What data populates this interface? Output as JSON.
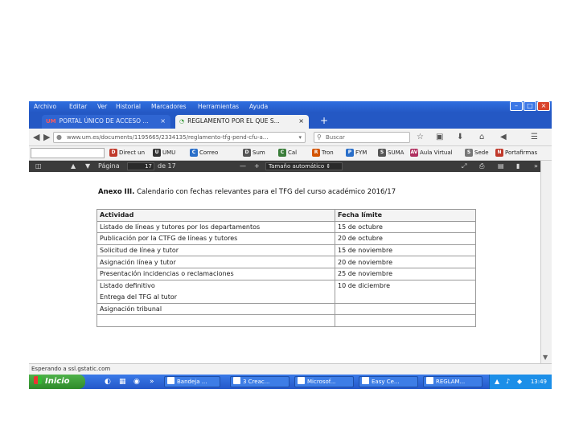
{
  "menu": [
    "Archivo",
    "Editar",
    "Ver",
    "Historial",
    "Marcadores",
    "Herramientas",
    "Ayuda"
  ],
  "tabs": [
    {
      "favicon": "UM",
      "label": "PORTAL ÚNICO DE ACCESO ...",
      "close": "×"
    },
    {
      "favicon": "◔",
      "label": "REGLAMENTO POR EL QUE S...",
      "close": "×"
    }
  ],
  "new_tab": "+",
  "nav": {
    "url": "www.um.es/documents/1195665/2334135/reglamento-tfg-pend-cfu-a...",
    "search_placeholder": "Buscar"
  },
  "bookmarks": [
    {
      "icon": "D",
      "label": "Direct un",
      "color": "#c0392b"
    },
    {
      "icon": "U",
      "label": "UMU",
      "color": "#333333"
    },
    {
      "icon": "C",
      "label": "Correo",
      "color": "#2a6fc9"
    },
    {
      "icon": "D",
      "label": "Sum",
      "color": "#555555"
    },
    {
      "icon": "C",
      "label": "Cal",
      "color": "#3a7d3a"
    },
    {
      "icon": "R",
      "label": "Tron",
      "color": "#d35400"
    },
    {
      "icon": "P",
      "label": "FYM",
      "color": "#2a6fc9"
    },
    {
      "icon": "S",
      "label": "SUMA",
      "color": "#555555"
    },
    {
      "icon": "AV",
      "label": "Aula Virtual",
      "color": "#b03060"
    },
    {
      "icon": "S",
      "label": "Sede",
      "color": "#777777"
    },
    {
      "icon": "N",
      "label": "Portafirmas",
      "color": "#c0392b"
    }
  ],
  "pdf": {
    "page_label": "Página",
    "page_current": "17",
    "page_total": "de 17",
    "zoom": "Tamaño automático"
  },
  "document": {
    "annex": "Anexo III.",
    "title_rest": " Calendario con fechas relevantes para el TFG del curso académico 2016/17",
    "headers": [
      "Actividad",
      "Fecha límite"
    ],
    "rows": [
      [
        "Listado de líneas y tutores por los departamentos",
        "15 de octubre"
      ],
      [
        "Publicación por la CTFG de líneas y tutores",
        "20 de octubre"
      ],
      [
        "Solicitud de línea y tutor",
        "15 de noviembre"
      ],
      [
        "Asignación línea y tutor",
        "20 de noviembre"
      ],
      [
        "Presentación incidencias o reclamaciones",
        "25 de noviembre"
      ],
      [
        "Listado definitivo",
        "10 de diciembre"
      ],
      [
        "Entrega del TFG al tutor",
        ""
      ],
      [
        "Asignación tribunal",
        ""
      ],
      [
        "",
        ""
      ]
    ]
  },
  "status": "Esperando a ssl.gstatic.com",
  "taskbar": {
    "start": "Inicio",
    "tasks": [
      "Bandeja ...",
      "3 Creac...",
      "Microsof...",
      "Easy Ce...",
      "REGLAM..."
    ],
    "clock": "13:49"
  }
}
